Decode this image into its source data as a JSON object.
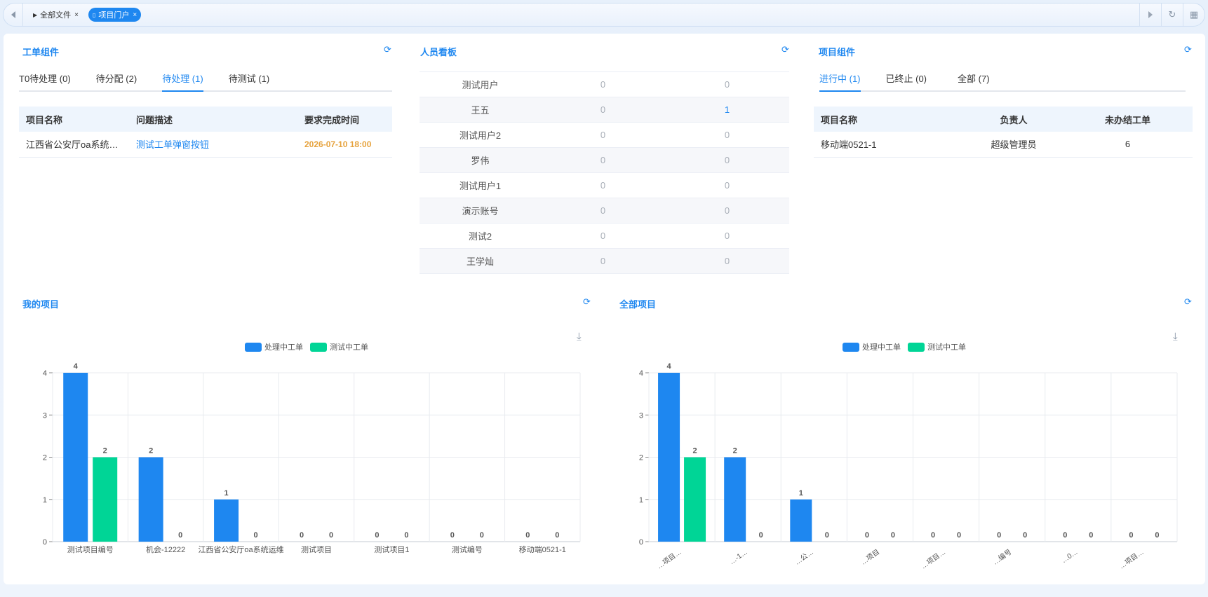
{
  "tabbar": {
    "tabs": [
      {
        "label": "全部文件",
        "close": "×"
      },
      {
        "label": "项目门户",
        "close": "×"
      }
    ]
  },
  "workorder": {
    "title": "工单组件",
    "tabs": [
      "T0待处理 (0)",
      "待分配 (2)",
      "待处理 (1)",
      "待测试 (1)"
    ],
    "active_tab": 2,
    "columns": [
      "项目名称",
      "问题描述",
      "要求完成时间"
    ],
    "rows": [
      {
        "project": "江西省公安厅oa系统…",
        "desc": "测试工单弹窗按钮",
        "due": "2026-07-10 18:00"
      }
    ]
  },
  "staff": {
    "title": "人员看板",
    "rows": [
      {
        "name": "测试用户",
        "a": "0",
        "b": "0"
      },
      {
        "name": "王五",
        "a": "0",
        "b": "1"
      },
      {
        "name": "测试用户2",
        "a": "0",
        "b": "0"
      },
      {
        "name": "罗伟",
        "a": "0",
        "b": "0"
      },
      {
        "name": "测试用户1",
        "a": "0",
        "b": "0"
      },
      {
        "name": "演示账号",
        "a": "0",
        "b": "0"
      },
      {
        "name": "测试2",
        "a": "0",
        "b": "0"
      },
      {
        "name": "王学灿",
        "a": "0",
        "b": "0"
      }
    ]
  },
  "projects": {
    "title": "项目组件",
    "tabs": [
      "进行中 (1)",
      "已终止 (0)",
      "全部 (7)"
    ],
    "active_tab": 0,
    "columns": [
      "项目名称",
      "负责人",
      "未办结工单"
    ],
    "rows": [
      {
        "name": "移动端0521-1",
        "owner": "超级管理员",
        "open": "6"
      }
    ]
  },
  "my_projects": {
    "title": "我的项目"
  },
  "all_projects": {
    "title": "全部项目"
  },
  "colors": {
    "accent": "#1e87f0",
    "series1": "#1e87f0",
    "series2": "#00d596",
    "due": "#e6a23c"
  },
  "chart_data": [
    {
      "type": "bar",
      "title": "",
      "categories": [
        "测试项目编号",
        "机会-12222",
        "江西省公安厅oa系统运维",
        "测试项目",
        "测试项目1",
        "测试编号",
        "移动端0521-1"
      ],
      "series": [
        {
          "name": "处理中工单",
          "values": [
            4,
            2,
            1,
            0,
            0,
            0,
            0
          ]
        },
        {
          "name": "测试中工单",
          "values": [
            2,
            0,
            0,
            0,
            0,
            0,
            0
          ]
        }
      ],
      "ylim": [
        0,
        4
      ],
      "yticks": [
        "0",
        "1",
        "2",
        "3",
        "4"
      ],
      "grid": true,
      "legend": "top-center"
    },
    {
      "type": "bar",
      "title": "",
      "categories": [
        "…项目…",
        "…-1…",
        "…公…",
        "…项目",
        "…项目…",
        "…编号",
        "…0…",
        "…项目…"
      ],
      "series": [
        {
          "name": "处理中工单",
          "values": [
            4,
            2,
            1,
            0,
            0,
            0,
            0,
            0
          ]
        },
        {
          "name": "测试中工单",
          "values": [
            2,
            0,
            0,
            0,
            0,
            0,
            0,
            0
          ]
        }
      ],
      "ylim": [
        0,
        4
      ],
      "yticks": [
        "0",
        "1",
        "2",
        "3",
        "4"
      ],
      "grid": true,
      "legend": "top-center",
      "xlabels_rotated": true
    }
  ]
}
